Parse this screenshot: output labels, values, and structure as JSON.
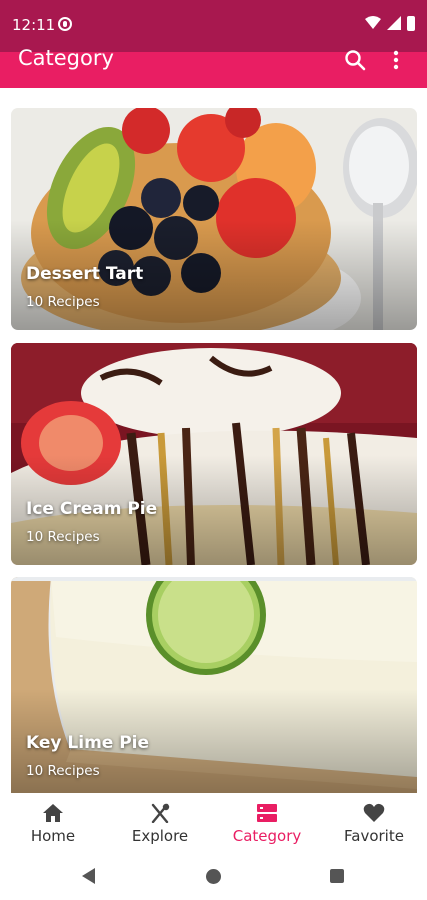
{
  "status_bar": {
    "time": "12:11"
  },
  "app_bar": {
    "title": "Category",
    "accent": "#e91e63",
    "status_color": "#a8184f"
  },
  "categories": [
    {
      "title": "Dessert Tart",
      "subtitle": "10 Recipes"
    },
    {
      "title": "Ice Cream Pie",
      "subtitle": "10 Recipes"
    },
    {
      "title": "Key Lime Pie",
      "subtitle": "10 Recipes"
    }
  ],
  "bottom_nav": {
    "items": [
      {
        "label": "Home",
        "icon": "home-icon"
      },
      {
        "label": "Explore",
        "icon": "utensils-icon"
      },
      {
        "label": "Category",
        "icon": "category-list-icon",
        "active": true
      },
      {
        "label": "Favorite",
        "icon": "heart-icon"
      }
    ]
  }
}
